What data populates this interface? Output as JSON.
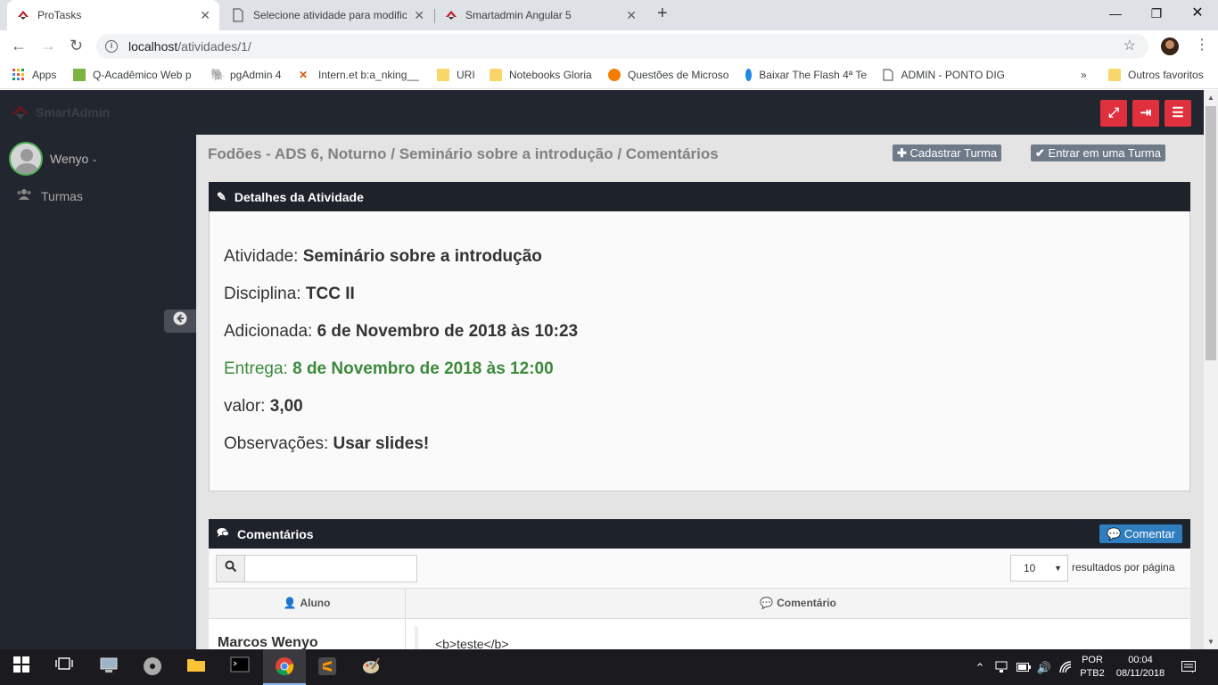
{
  "browser": {
    "tabs": [
      {
        "title": "ProTasks",
        "active": true
      },
      {
        "title": "Selecione atividade para modific",
        "active": false
      },
      {
        "title": "Smartadmin Angular 5",
        "active": false
      }
    ],
    "url_host": "localhost",
    "url_path": "/atividades/1/",
    "bookmarks": [
      "Apps",
      "Q-Acadêmico Web p",
      "pgAdmin 4",
      "Intern.et b:a_nking__",
      "URI",
      "Notebooks Gloria",
      "Questões de Microso",
      "Baixar The Flash 4ª Te",
      "ADMIN - PONTO DIG"
    ],
    "overflow": "»",
    "other_favorites": "Outros favoritos"
  },
  "app": {
    "logo_text": "SmartAdmin",
    "user_name": "Wenyo",
    "nav": [
      {
        "label": "Turmas",
        "icon": "users-icon"
      }
    ],
    "header_buttons": [
      "fullscreen-icon",
      "logout-icon",
      "menu-icon"
    ],
    "breadcrumb": "Fodões - ADS 6, Noturno / Seminário sobre a introdução / Comentários",
    "btn_cadastrar": "Cadastrar Turma",
    "btn_entrar": "Entrar em uma Turma"
  },
  "details": {
    "title": "Detalhes da Atividade",
    "rows": [
      {
        "label": "Atividade: ",
        "value": "Seminário sobre a introdução"
      },
      {
        "label": "Disciplina: ",
        "value": "TCC II"
      },
      {
        "label": "Adicionada: ",
        "value": "6 de Novembro de 2018 às 10:23"
      },
      {
        "label": "Entrega: ",
        "value": "8 de Novembro de 2018 às 12:00"
      },
      {
        "label": "valor: ",
        "value": "3,00"
      },
      {
        "label": "Observações: ",
        "value": "Usar slides!"
      }
    ]
  },
  "comments": {
    "title": "Comentários",
    "btn_comentar": "Comentar",
    "search_value": "",
    "page_size": "10",
    "per_page_label": "resultados por página",
    "columns": [
      "Aluno",
      "Comentário"
    ],
    "rows": [
      {
        "aluno": "Marcos Wenyo",
        "comentario": "<b>teste</b>"
      }
    ]
  },
  "taskbar": {
    "lang": "POR",
    "lang2": "PTB2",
    "time": "00:04",
    "date": "08/11/2018"
  },
  "colors": {
    "header_bg": "#22262e",
    "accent_red": "#e0303e",
    "entrega_green": "#3c8a3c",
    "btn_blue": "#2f7ec0"
  }
}
